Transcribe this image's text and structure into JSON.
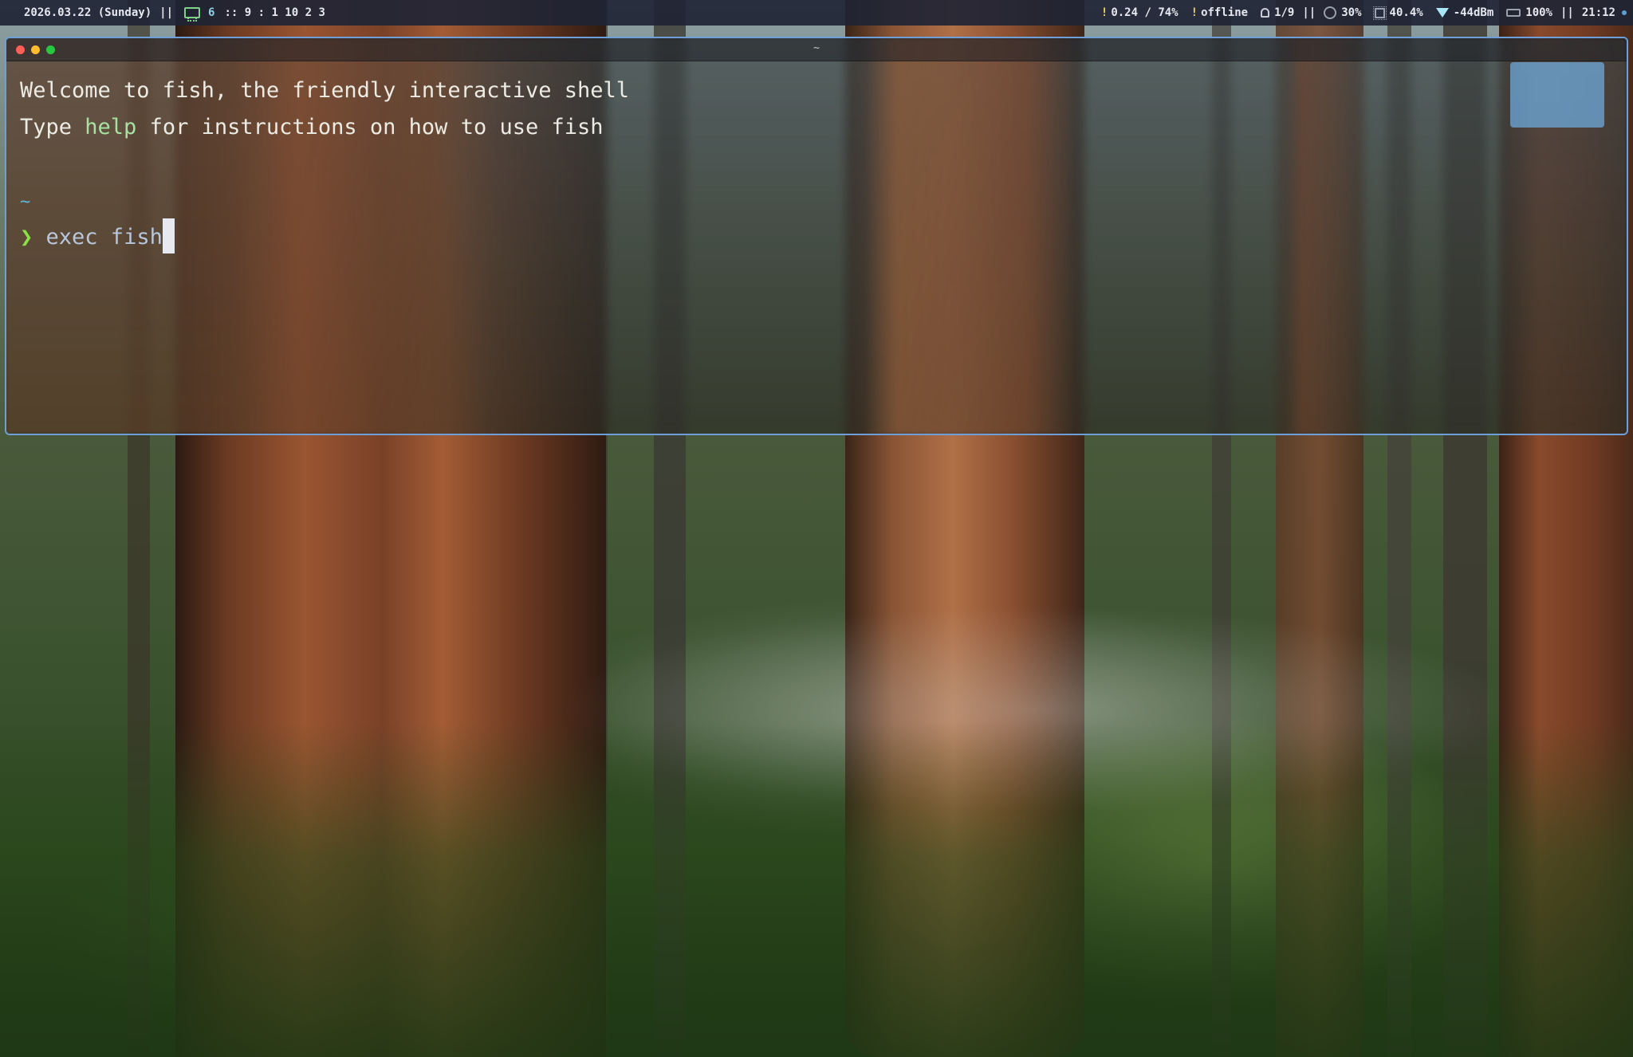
{
  "statusbar": {
    "date": "2026.03.22 (Sunday)",
    "sep": "||",
    "workspace_active": "6",
    "workspace_list": ":: 9 : 1 10 2 3",
    "load": "0.24 / 74%",
    "network_state": "offline",
    "updates": "1/9",
    "sep_right": "||",
    "fan": "30%",
    "cpu": "40.4%",
    "wifi_signal": "-44dBm",
    "battery": "100%",
    "sep_time": "||",
    "time": "21:12",
    "warn_mark": "!"
  },
  "terminal": {
    "window_title": "~",
    "welcome_line": "Welcome to fish, the friendly interactive shell",
    "help_prefix": "Type ",
    "help_keyword": "help",
    "help_suffix": " for instructions on how to use fish",
    "cwd": "~",
    "prompt_symbol": "❯",
    "command": "exec fish"
  },
  "colors": {
    "accent_border": "#6f9fd8",
    "help_keyword": "#a6e3a1",
    "prompt": "#8be04a",
    "cwd": "#5fb7d9",
    "active_workspace": "#8fd3e8"
  }
}
